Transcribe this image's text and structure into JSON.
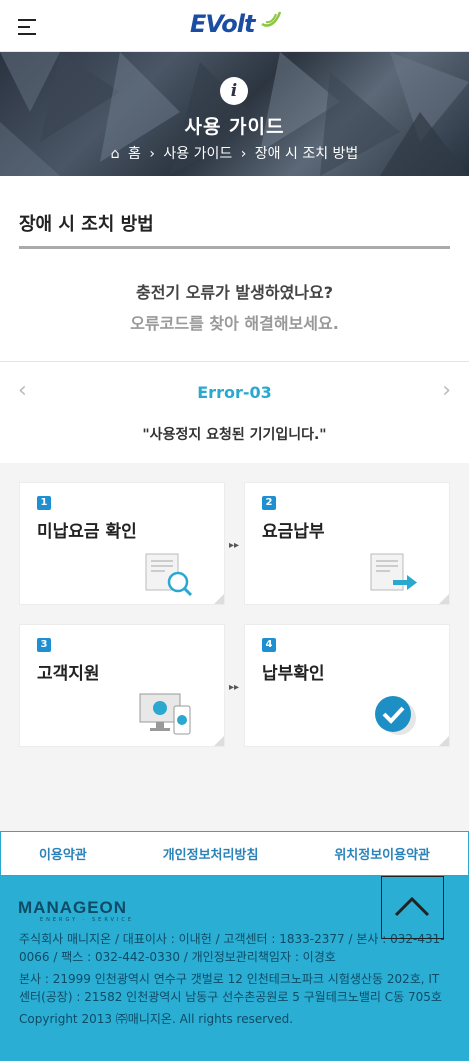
{
  "header": {
    "logo_text": "EVolt",
    "menu_icon": "hamburger-icon"
  },
  "hero": {
    "info_glyph": "i",
    "title": "사용 가이드",
    "breadcrumb": [
      "홈",
      "사용 가이드",
      "장애 시 조치 방법"
    ]
  },
  "section": {
    "title": "장애 시 조치 방법"
  },
  "question": {
    "line1": "충전기 오류가 발생하였나요?",
    "line2": "오류코드를 찾아 해결해보세요."
  },
  "error": {
    "code": "Error-03",
    "message": "\"사용정지 요청된 기기입니다.\""
  },
  "steps": [
    {
      "num": "1",
      "label": "미납요금 확인",
      "icon": "invoice-search-icon"
    },
    {
      "num": "2",
      "label": "요금납부",
      "icon": "invoice-send-icon"
    },
    {
      "num": "3",
      "label": "고객지원",
      "icon": "devices-icon"
    },
    {
      "num": "4",
      "label": "납부확인",
      "icon": "check-circle-icon"
    }
  ],
  "footer_links": [
    "이용약관",
    "개인정보처리방침",
    "위치정보이용약관"
  ],
  "footer": {
    "brand": "MANAGEON",
    "brand_sub": "ENERGY · SERVICE",
    "company_line": "주식회사 매니지온 / 대표이사 : 이내헌 / 고객센터 : 1833-2377 / 본사 : 032-431-0066 / 팩스 : 032-442-0330 / 개인정보관리책임자 : 이경호",
    "address_line": "본사 : 21999 인천광역시 연수구 갯벌로 12 인천테크노파크 시험생산동 202호, IT센터(공장) : 21582 인천광역시 남동구 선수촌공원로 5 구월테크노밸리 C동 705호",
    "copyright": "Copyright 2013 ㈜매니지온. All rights reserved."
  },
  "colors": {
    "accent": "#2aa8d0",
    "footer_bg": "#2aaed4",
    "logo": "#1b4ea3",
    "step_badge": "#1e8fd0"
  }
}
